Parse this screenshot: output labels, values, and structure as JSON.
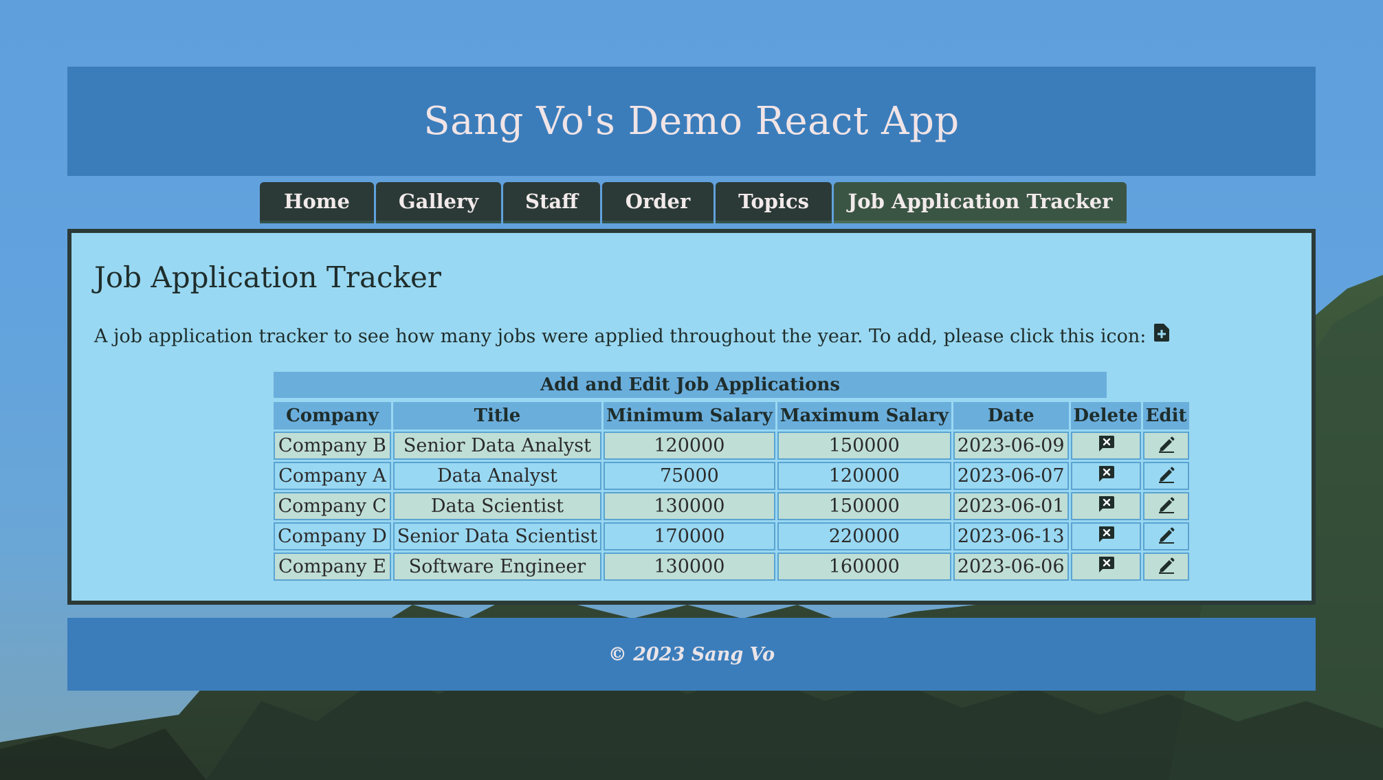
{
  "app": {
    "title": "Sang Vo's Demo React App"
  },
  "nav": {
    "tabs": [
      {
        "label": "Home"
      },
      {
        "label": "Gallery"
      },
      {
        "label": "Staff"
      },
      {
        "label": "Order"
      },
      {
        "label": "Topics"
      },
      {
        "label": "Job Application Tracker",
        "active": true
      }
    ]
  },
  "main": {
    "heading": "Job Application Tracker",
    "description": "A job application tracker to see how many jobs were applied throughout the year. To add, please click this icon:",
    "add_icon": "file-plus-icon",
    "table": {
      "caption": "Add and Edit Job Applications",
      "columns": [
        "Company",
        "Title",
        "Minimum Salary",
        "Maximum Salary",
        "Date",
        "Delete",
        "Edit"
      ],
      "rows": [
        {
          "company": "Company B",
          "title": "Senior Data Analyst",
          "min_salary": "120000",
          "max_salary": "150000",
          "date": "2023-06-09"
        },
        {
          "company": "Company A",
          "title": "Data Analyst",
          "min_salary": "75000",
          "max_salary": "120000",
          "date": "2023-06-07"
        },
        {
          "company": "Company C",
          "title": "Data Scientist",
          "min_salary": "130000",
          "max_salary": "150000",
          "date": "2023-06-01"
        },
        {
          "company": "Company D",
          "title": "Senior Data Scientist",
          "min_salary": "170000",
          "max_salary": "220000",
          "date": "2023-06-13"
        },
        {
          "company": "Company E",
          "title": "Software Engineer",
          "min_salary": "130000",
          "max_salary": "160000",
          "date": "2023-06-06"
        }
      ],
      "delete_icon": "message-x-icon",
      "edit_icon": "pencil-icon"
    }
  },
  "footer": {
    "text": "© 2023 Sang Vo"
  },
  "colors": {
    "header_bg": "#3b7dbb",
    "nav_bg": "#2b3a37",
    "nav_active_bg": "#3b5545",
    "panel_bg": "#99d8f2",
    "table_header_bg": "#6aaedc",
    "row_alt_bg": "#bfded6"
  }
}
